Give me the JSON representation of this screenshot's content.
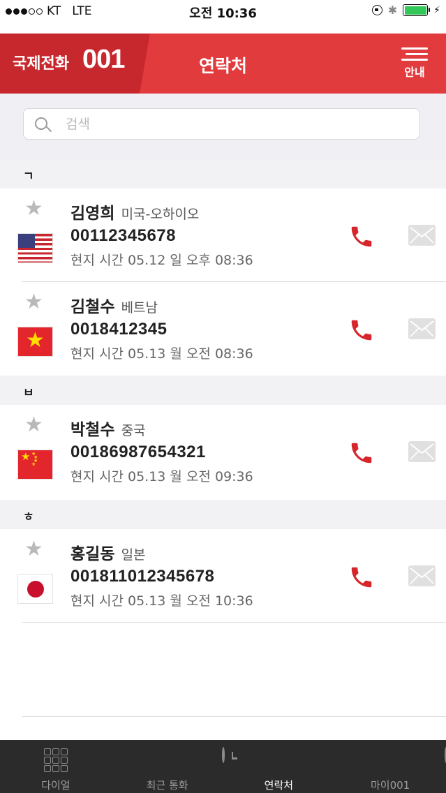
{
  "status_bar": {
    "carrier": "KT",
    "network": "LTE",
    "time": "오전 10:36"
  },
  "header": {
    "brand_text": "국제전화",
    "brand_number": "001",
    "title": "연락처",
    "guide_label": "안내"
  },
  "search": {
    "placeholder": "검색"
  },
  "sections": [
    {
      "label": "ㄱ",
      "contacts": [
        {
          "name": "김영희",
          "region": "미국-오하이오",
          "number": "00112345678",
          "local_time": "현지 시간 05.12 일 오후 08:36",
          "flag": "us-flag"
        },
        {
          "name": "김철수",
          "region": "베트남",
          "number": "0018412345",
          "local_time": "현지 시간 05.13 월 오전 08:36",
          "flag": "vietnam-flag"
        }
      ]
    },
    {
      "label": "ㅂ",
      "contacts": [
        {
          "name": "박철수",
          "region": "중국",
          "number": "00186987654321",
          "local_time": "현지 시간 05.13 월 오전 09:36",
          "flag": "china-flag"
        }
      ]
    },
    {
      "label": "ㅎ",
      "contacts": [
        {
          "name": "홍길동",
          "region": "일본",
          "number": "001811012345678",
          "local_time": "현지 시간 05.13 월 오전 10:36",
          "flag": "japan-flag"
        }
      ]
    }
  ],
  "tabbar": {
    "tabs": [
      {
        "label": "다이얼",
        "icon": "keypad-icon",
        "active": false
      },
      {
        "label": "최근 통화",
        "icon": "clock-icon",
        "active": false
      },
      {
        "label": "연락처",
        "icon": "contacts-book-icon",
        "active": true
      },
      {
        "label": "마이001",
        "icon": "profile-icon",
        "active": false
      }
    ]
  },
  "colors": {
    "header_red": "#e23b3e",
    "brand_red": "#c7282d",
    "call_red": "#d6262b",
    "active_tab_orange": "#f05a23",
    "tab_bar_bg": "#2b2b2b"
  }
}
